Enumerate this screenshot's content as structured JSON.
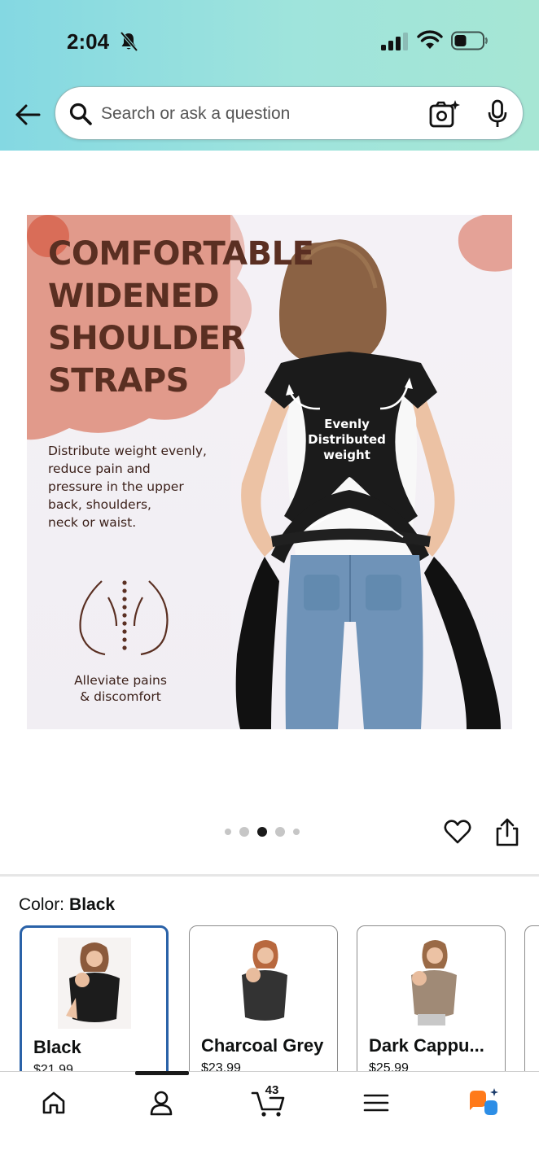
{
  "status_bar": {
    "time": "2:04"
  },
  "search": {
    "placeholder": "Search or ask a question"
  },
  "product_image": {
    "headline": "COMFORTABLE\nWIDENED\nSHOULDER\nSTRAPS",
    "body": "Distribute weight evenly,\nreduce pain and\npressure in the upper\nback, shoulders,\nneck or waist.",
    "callout": "Evenly\nDistributed\nweight",
    "caption": "Alleviate pains\n& discomfort"
  },
  "carousel": {
    "total": 5,
    "active_index": 2
  },
  "color_selector": {
    "label": "Color:",
    "selected": "Black",
    "options": [
      {
        "name": "Black",
        "price": "$21.99",
        "color": "#1c1c1c"
      },
      {
        "name": "Charcoal Grey",
        "price": "$23.99",
        "color": "#333333"
      },
      {
        "name": "Dark Cappu...",
        "price": "$25.99",
        "color": "#a08a76"
      }
    ]
  },
  "bottom_nav": {
    "items": [
      "home-icon",
      "account-icon",
      "cart-icon",
      "menu-icon",
      "rufus-icon"
    ],
    "cart_count": "43",
    "active": "account-icon"
  },
  "colors": {
    "header_gradient_start": "#84d8e2",
    "header_gradient_end": "#a6e6d4",
    "selected_border": "#2a62a8",
    "headline_text": "#5a2f22",
    "blob": "#e19a8b",
    "accent_orange": "#ff7a1a",
    "accent_blue": "#2d8ee6"
  }
}
